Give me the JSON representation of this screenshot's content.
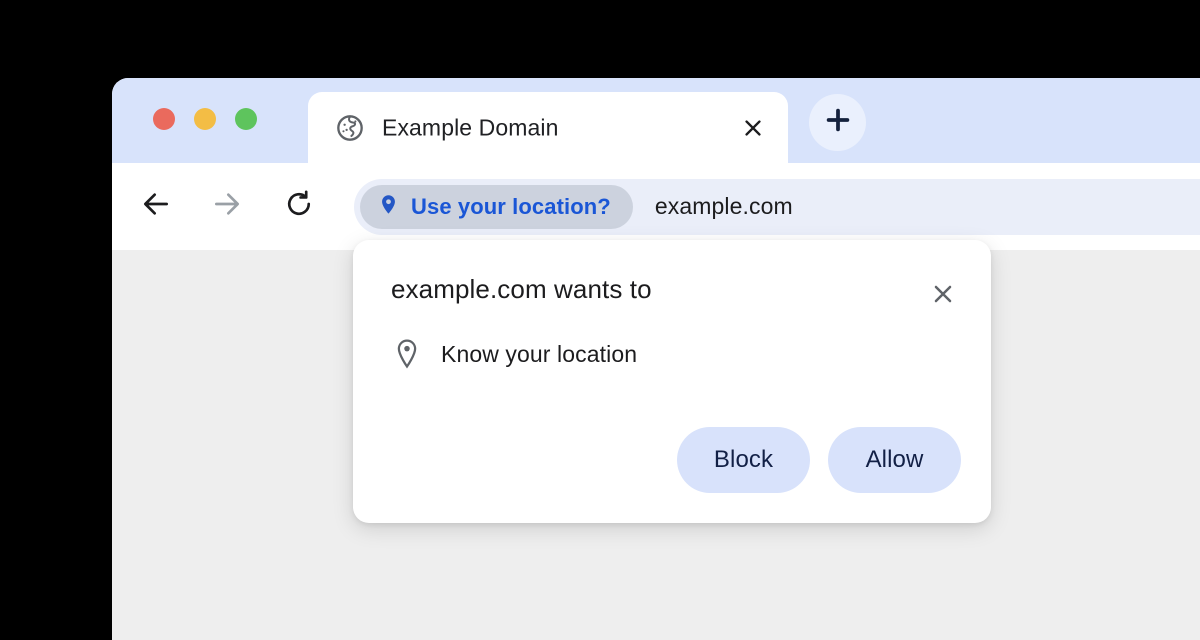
{
  "window": {
    "traffic_lights": [
      {
        "name": "close",
        "color": "#ea6a5d"
      },
      {
        "name": "minimize",
        "color": "#f3bd45"
      },
      {
        "name": "maximize",
        "color": "#5ec45d"
      }
    ]
  },
  "tab_strip": {
    "active_tab": {
      "title": "Example Domain",
      "favicon": "globe-icon",
      "close_icon": "close-icon"
    },
    "new_tab_icon": "plus-icon"
  },
  "toolbar": {
    "back_icon": "arrow-left-icon",
    "forward_icon": "arrow-right-icon",
    "reload_icon": "reload-icon",
    "location_chip": {
      "icon": "location-pin-icon",
      "label": "Use your location?",
      "label_color": "#1a56d6",
      "chip_color": "#ccd2de"
    },
    "url": "example.com"
  },
  "permission_dialog": {
    "title": "example.com wants to",
    "close_icon": "close-icon",
    "item": {
      "icon": "location-pin-outline-icon",
      "label": "Know your location"
    },
    "buttons": [
      {
        "name": "block",
        "label": "Block"
      },
      {
        "name": "allow",
        "label": "Allow"
      }
    ],
    "button_bg": "#d8e2fb",
    "button_text_color": "#122046"
  }
}
